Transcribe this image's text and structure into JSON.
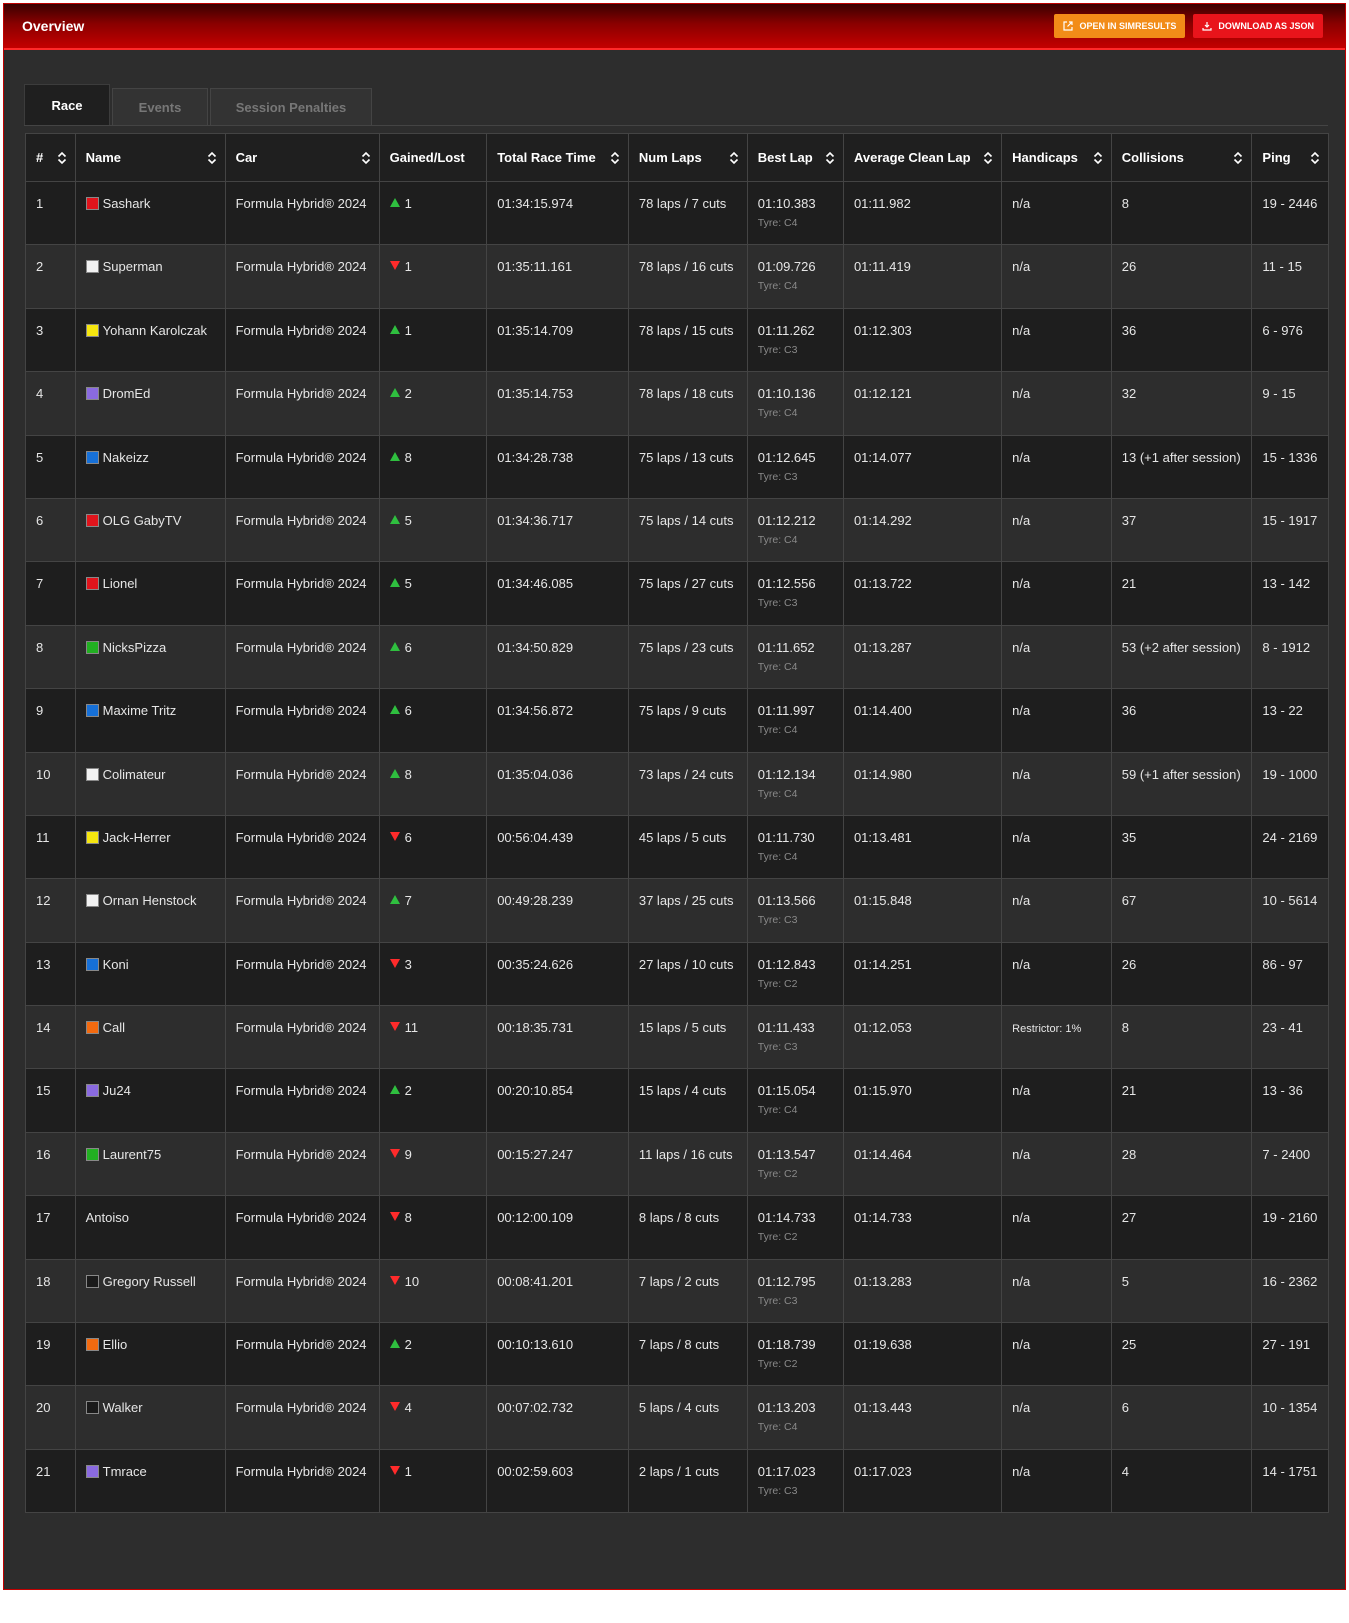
{
  "header": {
    "title": "Overview",
    "simresults_label": "OPEN IN SIMRESULTS",
    "download_label": "DOWNLOAD AS JSON"
  },
  "tabs": [
    {
      "label": "Race",
      "active": true
    },
    {
      "label": "Events",
      "active": false
    },
    {
      "label": "Session Penalties",
      "active": false
    }
  ],
  "columns": [
    "#",
    "Name",
    "Car",
    "Gained/Lost",
    "Total Race Time",
    "Num Laps",
    "Best Lap",
    "Average Clean Lap",
    "Handicaps",
    "Collisions",
    "Ping"
  ],
  "rows": [
    {
      "pos": "1",
      "name": "Sashark",
      "color": "#e0141c",
      "car": "Formula Hybrid® 2024",
      "dir": "up",
      "gl": "1",
      "time": "01:34:15.974",
      "laps": "78 laps / 7 cuts",
      "best": "01:10.383",
      "tyre": "Tyre: C4",
      "avg": "01:11.982",
      "hcap": "n/a",
      "coll": "8",
      "ping": "19 - 2446"
    },
    {
      "pos": "2",
      "name": "Superman",
      "color": "#f2f2f2",
      "car": "Formula Hybrid® 2024",
      "dir": "down",
      "gl": "1",
      "time": "01:35:11.161",
      "laps": "78 laps / 16 cuts",
      "best": "01:09.726",
      "tyre": "Tyre: C4",
      "avg": "01:11.419",
      "hcap": "n/a",
      "coll": "26",
      "ping": "11 - 15"
    },
    {
      "pos": "3",
      "name": "Yohann Karolczak",
      "color": "#f5e60f",
      "car": "Formula Hybrid® 2024",
      "dir": "up",
      "gl": "1",
      "time": "01:35:14.709",
      "laps": "78 laps / 15 cuts",
      "best": "01:11.262",
      "tyre": "Tyre: C3",
      "avg": "01:12.303",
      "hcap": "n/a",
      "coll": "36",
      "ping": "6 - 976"
    },
    {
      "pos": "4",
      "name": "DromEd",
      "color": "#8a6ae0",
      "car": "Formula Hybrid® 2024",
      "dir": "up",
      "gl": "2",
      "time": "01:35:14.753",
      "laps": "78 laps / 18 cuts",
      "best": "01:10.136",
      "tyre": "Tyre: C4",
      "avg": "01:12.121",
      "hcap": "n/a",
      "coll": "32",
      "ping": "9 - 15"
    },
    {
      "pos": "5",
      "name": "Nakeizz",
      "color": "#1670d8",
      "car": "Formula Hybrid® 2024",
      "dir": "up",
      "gl": "8",
      "time": "01:34:28.738",
      "laps": "75 laps / 13 cuts",
      "best": "01:12.645",
      "tyre": "Tyre: C3",
      "avg": "01:14.077",
      "hcap": "n/a",
      "coll": "13 (+1 after session)",
      "ping": "15 - 1336"
    },
    {
      "pos": "6",
      "name": "OLG GabyTV",
      "color": "#e0141c",
      "car": "Formula Hybrid® 2024",
      "dir": "up",
      "gl": "5",
      "time": "01:34:36.717",
      "laps": "75 laps / 14 cuts",
      "best": "01:12.212",
      "tyre": "Tyre: C4",
      "avg": "01:14.292",
      "hcap": "n/a",
      "coll": "37",
      "ping": "15 - 1917"
    },
    {
      "pos": "7",
      "name": "Lionel",
      "color": "#e0141c",
      "car": "Formula Hybrid® 2024",
      "dir": "up",
      "gl": "5",
      "time": "01:34:46.085",
      "laps": "75 laps / 27 cuts",
      "best": "01:12.556",
      "tyre": "Tyre: C3",
      "avg": "01:13.722",
      "hcap": "n/a",
      "coll": "21",
      "ping": "13 - 142"
    },
    {
      "pos": "8",
      "name": "NicksPizza",
      "color": "#22b022",
      "car": "Formula Hybrid® 2024",
      "dir": "up",
      "gl": "6",
      "time": "01:34:50.829",
      "laps": "75 laps / 23 cuts",
      "best": "01:11.652",
      "tyre": "Tyre: C4",
      "avg": "01:13.287",
      "hcap": "n/a",
      "coll": "53 (+2 after session)",
      "ping": "8 - 1912"
    },
    {
      "pos": "9",
      "name": "Maxime Tritz",
      "color": "#1670d8",
      "car": "Formula Hybrid® 2024",
      "dir": "up",
      "gl": "6",
      "time": "01:34:56.872",
      "laps": "75 laps / 9 cuts",
      "best": "01:11.997",
      "tyre": "Tyre: C4",
      "avg": "01:14.400",
      "hcap": "n/a",
      "coll": "36",
      "ping": "13 - 22"
    },
    {
      "pos": "10",
      "name": "Colimateur",
      "color": "#f2f2f2",
      "car": "Formula Hybrid® 2024",
      "dir": "up",
      "gl": "8",
      "time": "01:35:04.036",
      "laps": "73 laps / 24 cuts",
      "best": "01:12.134",
      "tyre": "Tyre: C4",
      "avg": "01:14.980",
      "hcap": "n/a",
      "coll": "59 (+1 after session)",
      "ping": "19 - 1000"
    },
    {
      "pos": "11",
      "name": "Jack-Herrer",
      "color": "#f5e60f",
      "car": "Formula Hybrid® 2024",
      "dir": "down",
      "gl": "6",
      "time": "00:56:04.439",
      "laps": "45 laps / 5 cuts",
      "best": "01:11.730",
      "tyre": "Tyre: C4",
      "avg": "01:13.481",
      "hcap": "n/a",
      "coll": "35",
      "ping": "24 - 2169"
    },
    {
      "pos": "12",
      "name": "Ornan Henstock",
      "color": "#f2f2f2",
      "car": "Formula Hybrid® 2024",
      "dir": "up",
      "gl": "7",
      "time": "00:49:28.239",
      "laps": "37 laps / 25 cuts",
      "best": "01:13.566",
      "tyre": "Tyre: C3",
      "avg": "01:15.848",
      "hcap": "n/a",
      "coll": "67",
      "ping": "10 - 5614"
    },
    {
      "pos": "13",
      "name": "Koni",
      "color": "#1670d8",
      "car": "Formula Hybrid® 2024",
      "dir": "down",
      "gl": "3",
      "time": "00:35:24.626",
      "laps": "27 laps / 10 cuts",
      "best": "01:12.843",
      "tyre": "Tyre: C2",
      "avg": "01:14.251",
      "hcap": "n/a",
      "coll": "26",
      "ping": "86 - 97"
    },
    {
      "pos": "14",
      "name": "Call",
      "color": "#f26a10",
      "car": "Formula Hybrid® 2024",
      "dir": "down",
      "gl": "11",
      "time": "00:18:35.731",
      "laps": "15 laps / 5 cuts",
      "best": "01:11.433",
      "tyre": "Tyre: C3",
      "avg": "01:12.053",
      "hcap": "Restrictor: 1%",
      "coll": "8",
      "ping": "23 - 41"
    },
    {
      "pos": "15",
      "name": "Ju24",
      "color": "#8a6ae0",
      "car": "Formula Hybrid® 2024",
      "dir": "up",
      "gl": "2",
      "time": "00:20:10.854",
      "laps": "15 laps / 4 cuts",
      "best": "01:15.054",
      "tyre": "Tyre: C4",
      "avg": "01:15.970",
      "hcap": "n/a",
      "coll": "21",
      "ping": "13 - 36"
    },
    {
      "pos": "16",
      "name": "Laurent75",
      "color": "#22b022",
      "car": "Formula Hybrid® 2024",
      "dir": "down",
      "gl": "9",
      "time": "00:15:27.247",
      "laps": "11 laps / 16 cuts",
      "best": "01:13.547",
      "tyre": "Tyre: C2",
      "avg": "01:14.464",
      "hcap": "n/a",
      "coll": "28",
      "ping": "7 - 2400"
    },
    {
      "pos": "17",
      "name": "Antoiso",
      "color": "",
      "car": "Formula Hybrid® 2024",
      "dir": "down",
      "gl": "8",
      "time": "00:12:00.109",
      "laps": "8 laps / 8 cuts",
      "best": "01:14.733",
      "tyre": "Tyre: C2",
      "avg": "01:14.733",
      "hcap": "n/a",
      "coll": "27",
      "ping": "19 - 2160"
    },
    {
      "pos": "18",
      "name": "Gregory Russell",
      "color": "#1a1a1a",
      "car": "Formula Hybrid® 2024",
      "dir": "down",
      "gl": "10",
      "time": "00:08:41.201",
      "laps": "7 laps / 2 cuts",
      "best": "01:12.795",
      "tyre": "Tyre: C3",
      "avg": "01:13.283",
      "hcap": "n/a",
      "coll": "5",
      "ping": "16 - 2362"
    },
    {
      "pos": "19",
      "name": "Ellio",
      "color": "#f26a10",
      "car": "Formula Hybrid® 2024",
      "dir": "up",
      "gl": "2",
      "time": "00:10:13.610",
      "laps": "7 laps / 8 cuts",
      "best": "01:18.739",
      "tyre": "Tyre: C2",
      "avg": "01:19.638",
      "hcap": "n/a",
      "coll": "25",
      "ping": "27 - 191"
    },
    {
      "pos": "20",
      "name": "Walker",
      "color": "#1a1a1a",
      "car": "Formula Hybrid® 2024",
      "dir": "down",
      "gl": "4",
      "time": "00:07:02.732",
      "laps": "5 laps / 4 cuts",
      "best": "01:13.203",
      "tyre": "Tyre: C4",
      "avg": "01:13.443",
      "hcap": "n/a",
      "coll": "6",
      "ping": "10 - 1354"
    },
    {
      "pos": "21",
      "name": "Tmrace",
      "color": "#8a6ae0",
      "car": "Formula Hybrid® 2024",
      "dir": "down",
      "gl": "1",
      "time": "00:02:59.603",
      "laps": "2 laps / 1 cuts",
      "best": "01:17.023",
      "tyre": "Tyre: C3",
      "avg": "01:17.023",
      "hcap": "n/a",
      "coll": "4",
      "ping": "14 - 1751"
    }
  ]
}
